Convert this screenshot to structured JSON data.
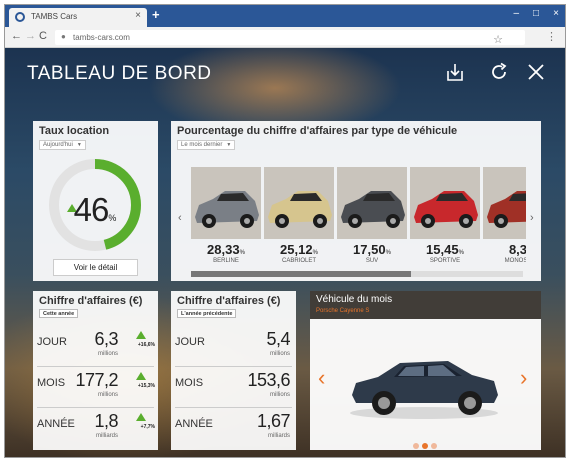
{
  "browser": {
    "tab_title": "TAMBS Cars",
    "tab_close": "×",
    "new_tab": "+",
    "url": "tambs-cars.com",
    "win_min": "–",
    "win_max": "□",
    "win_close": "×"
  },
  "dashboard": {
    "title": "TABLEAU DE BORD",
    "icons": [
      "download-icon",
      "refresh-icon",
      "close-icon"
    ]
  },
  "taux": {
    "title": "Taux location",
    "period": "Aujourd'hui",
    "value": "46",
    "unit": "%",
    "fill_fraction": 0.46,
    "detail_button": "Voir le détail",
    "accent": "#5aae2e"
  },
  "pourcentage": {
    "title": "Pourcentage du chiffre d'affaires par type de véhicule",
    "period": "Le mois dernier",
    "items": [
      {
        "value": "28,33",
        "unit": "%",
        "label": "BERLINE",
        "color": "#7a7f86"
      },
      {
        "value": "25,12",
        "unit": "%",
        "label": "CABRIOLET",
        "color": "#d6c58e"
      },
      {
        "value": "17,50",
        "unit": "%",
        "label": "SUV",
        "color": "#4a4d52"
      },
      {
        "value": "15,45",
        "unit": "%",
        "label": "SPORTIVE",
        "color": "#c8282c"
      },
      {
        "value": "8,3",
        "unit": "",
        "label": "MONOSP",
        "color": "#a03026"
      }
    ]
  },
  "ca_current": {
    "title": "Chiffre d'affaires (€)",
    "period": "Cette année",
    "rows": [
      {
        "label": "JOUR",
        "value": "6,3",
        "unit": "millions",
        "delta": "+16,6%"
      },
      {
        "label": "MOIS",
        "value": "177,2",
        "unit": "millions",
        "delta": "+15,3%"
      },
      {
        "label": "ANNÉE",
        "value": "1,8",
        "unit": "milliards",
        "delta": "+7,7%"
      }
    ]
  },
  "ca_previous": {
    "title": "Chiffre d'affaires (€)",
    "period": "L'année précédente",
    "rows": [
      {
        "label": "JOUR",
        "value": "5,4",
        "unit": "millions"
      },
      {
        "label": "MOIS",
        "value": "153,6",
        "unit": "millions"
      },
      {
        "label": "ANNÉE",
        "value": "1,67",
        "unit": "milliards"
      }
    ]
  },
  "vehicle": {
    "title": "Véhicule du mois",
    "subtitle": "Porsche Cayenne S",
    "prev": "‹",
    "next": "›",
    "accent": "#e8742a",
    "active_dot": 1
  }
}
